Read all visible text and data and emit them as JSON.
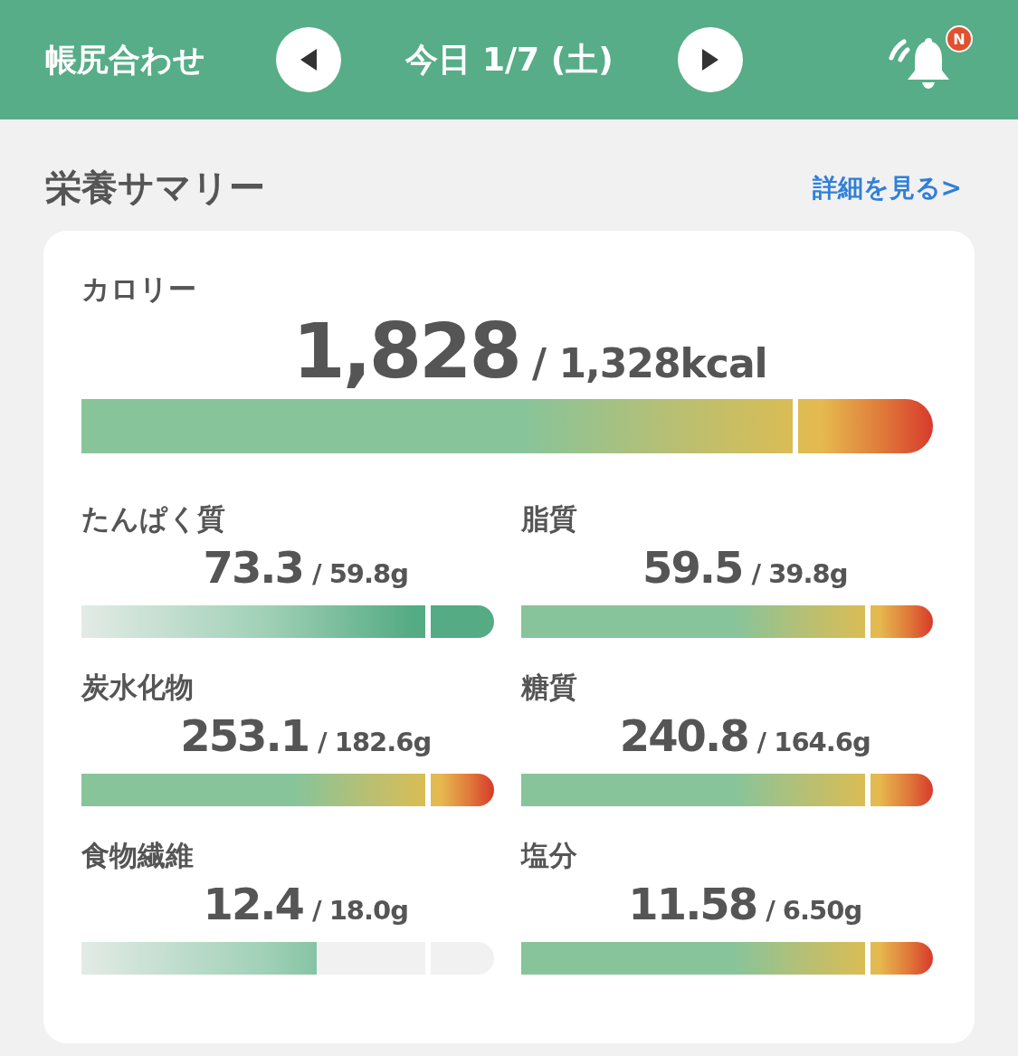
{
  "header": {
    "title": "帳尻合わせ",
    "date": "今日 1/7 (土)",
    "badge": "N"
  },
  "section": {
    "title": "栄養サマリー",
    "link": "詳細を見る>"
  },
  "calorie": {
    "label": "カロリー",
    "value": "1,828",
    "target": "/ 1,328kcal",
    "level": 1,
    "kind": "excess"
  },
  "nutrients": [
    {
      "label": "たんぱく質",
      "value": "73.3",
      "target": "/ 59.8g",
      "level": 1,
      "kind": "plain"
    },
    {
      "label": "脂質",
      "value": "59.5",
      "target": "/ 39.8g",
      "level": 1,
      "kind": "excess"
    },
    {
      "label": "炭水化物",
      "value": "253.1",
      "target": "/ 182.6g",
      "level": 1,
      "kind": "excess"
    },
    {
      "label": "糖質",
      "value": "240.8",
      "target": "/ 164.6g",
      "level": 1,
      "kind": "excess"
    },
    {
      "label": "食物繊維",
      "value": "12.4",
      "target": "/ 18.0g",
      "level": 0.57,
      "kind": "plain"
    },
    {
      "label": "塩分",
      "value": "11.58",
      "target": "/ 6.50g",
      "level": 1,
      "kind": "excess"
    }
  ]
}
